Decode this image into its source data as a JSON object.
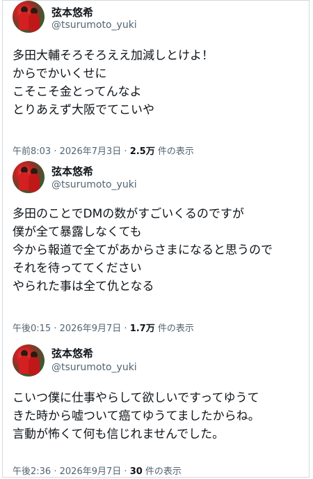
{
  "tweets": [
    {
      "name": "弦本悠希",
      "handle": "@tsurumoto_yuki",
      "text": "多田大輔そろそろええ加減しとけよ！\nからでかいくせに\nこそこそ金とってんなよ\nとりあえず大阪でてこいや",
      "time": "午前8:03",
      "date": "2026年7月3日",
      "views_count": "2.5万",
      "views_label": "件の表示"
    },
    {
      "name": "弦本悠希",
      "handle": "@tsurumoto_yuki",
      "text": "多田のことでDMの数がすごいくるのですが\n僕が全て暴露しなくても\n今から報道で全てがあからさまになると思うので\nそれを待っててください\nやられた事は全て仇となる",
      "time": "午後0:15",
      "date": "2026年9月7日",
      "views_count": "1.7万",
      "views_label": "件の表示"
    },
    {
      "name": "弦本悠希",
      "handle": "@tsurumoto_yuki",
      "text": "こいつ僕に仕事やらして欲しいですってゆうて\nきた時から嘘ついて癌てゆうてましたからね。\n言動が怖くて何も信じれませんでした。",
      "time": "午後2:36",
      "date": "2026年9月7日",
      "views_count": "30",
      "views_label": "件の表示"
    }
  ],
  "separator": "·"
}
